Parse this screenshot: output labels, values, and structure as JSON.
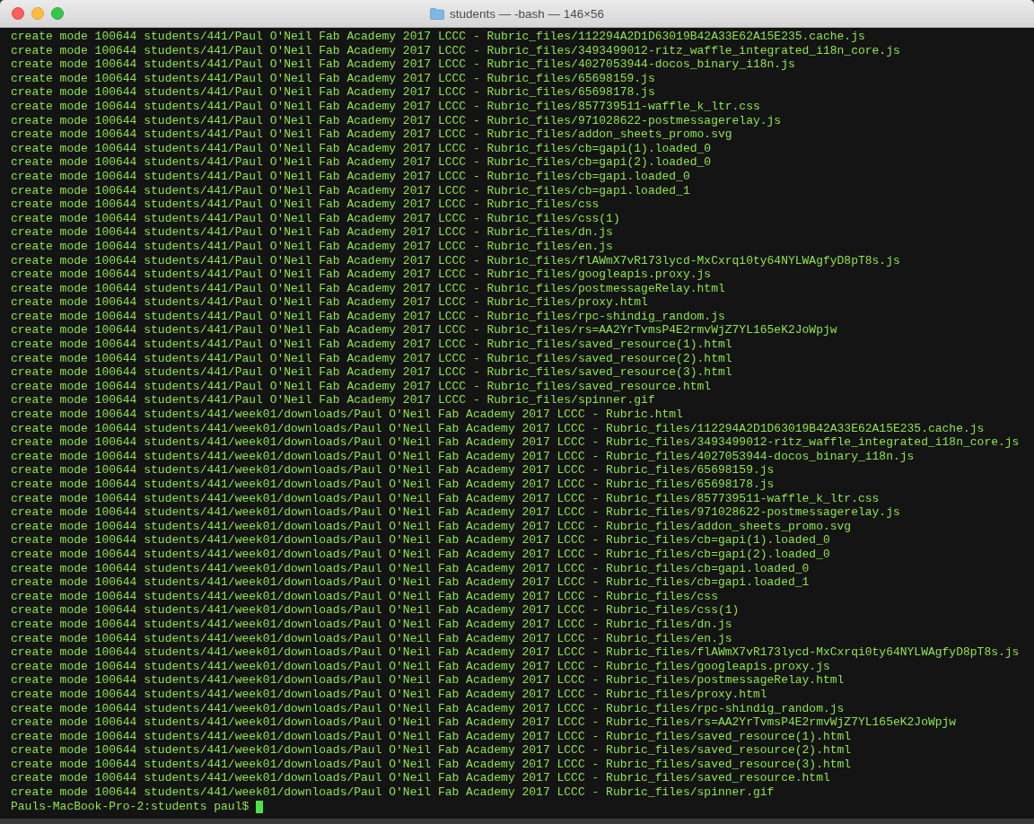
{
  "window": {
    "title": "students — -bash — 146×56"
  },
  "lines": [
    "create mode 100644 students/441/Paul O'Neil Fab Academy 2017 LCCC - Rubric_files/112294A2D1D63019B42A33E62A15E235.cache.js",
    "create mode 100644 students/441/Paul O'Neil Fab Academy 2017 LCCC - Rubric_files/3493499012-ritz_waffle_integrated_i18n_core.js",
    "create mode 100644 students/441/Paul O'Neil Fab Academy 2017 LCCC - Rubric_files/4027053944-docos_binary_i18n.js",
    "create mode 100644 students/441/Paul O'Neil Fab Academy 2017 LCCC - Rubric_files/65698159.js",
    "create mode 100644 students/441/Paul O'Neil Fab Academy 2017 LCCC - Rubric_files/65698178.js",
    "create mode 100644 students/441/Paul O'Neil Fab Academy 2017 LCCC - Rubric_files/857739511-waffle_k_ltr.css",
    "create mode 100644 students/441/Paul O'Neil Fab Academy 2017 LCCC - Rubric_files/971028622-postmessagerelay.js",
    "create mode 100644 students/441/Paul O'Neil Fab Academy 2017 LCCC - Rubric_files/addon_sheets_promo.svg",
    "create mode 100644 students/441/Paul O'Neil Fab Academy 2017 LCCC - Rubric_files/cb=gapi(1).loaded_0",
    "create mode 100644 students/441/Paul O'Neil Fab Academy 2017 LCCC - Rubric_files/cb=gapi(2).loaded_0",
    "create mode 100644 students/441/Paul O'Neil Fab Academy 2017 LCCC - Rubric_files/cb=gapi.loaded_0",
    "create mode 100644 students/441/Paul O'Neil Fab Academy 2017 LCCC - Rubric_files/cb=gapi.loaded_1",
    "create mode 100644 students/441/Paul O'Neil Fab Academy 2017 LCCC - Rubric_files/css",
    "create mode 100644 students/441/Paul O'Neil Fab Academy 2017 LCCC - Rubric_files/css(1)",
    "create mode 100644 students/441/Paul O'Neil Fab Academy 2017 LCCC - Rubric_files/dn.js",
    "create mode 100644 students/441/Paul O'Neil Fab Academy 2017 LCCC - Rubric_files/en.js",
    "create mode 100644 students/441/Paul O'Neil Fab Academy 2017 LCCC - Rubric_files/flAWmX7vR173lycd-MxCxrqi0ty64NYLWAgfyD8pT8s.js",
    "create mode 100644 students/441/Paul O'Neil Fab Academy 2017 LCCC - Rubric_files/googleapis.proxy.js",
    "create mode 100644 students/441/Paul O'Neil Fab Academy 2017 LCCC - Rubric_files/postmessageRelay.html",
    "create mode 100644 students/441/Paul O'Neil Fab Academy 2017 LCCC - Rubric_files/proxy.html",
    "create mode 100644 students/441/Paul O'Neil Fab Academy 2017 LCCC - Rubric_files/rpc-shindig_random.js",
    "create mode 100644 students/441/Paul O'Neil Fab Academy 2017 LCCC - Rubric_files/rs=AA2YrTvmsP4E2rmvWjZ7YL165eK2JoWpjw",
    "create mode 100644 students/441/Paul O'Neil Fab Academy 2017 LCCC - Rubric_files/saved_resource(1).html",
    "create mode 100644 students/441/Paul O'Neil Fab Academy 2017 LCCC - Rubric_files/saved_resource(2).html",
    "create mode 100644 students/441/Paul O'Neil Fab Academy 2017 LCCC - Rubric_files/saved_resource(3).html",
    "create mode 100644 students/441/Paul O'Neil Fab Academy 2017 LCCC - Rubric_files/saved_resource.html",
    "create mode 100644 students/441/Paul O'Neil Fab Academy 2017 LCCC - Rubric_files/spinner.gif",
    "create mode 100644 students/441/week01/downloads/Paul O'Neil Fab Academy 2017 LCCC - Rubric.html",
    "create mode 100644 students/441/week01/downloads/Paul O'Neil Fab Academy 2017 LCCC - Rubric_files/112294A2D1D63019B42A33E62A15E235.cache.js",
    "create mode 100644 students/441/week01/downloads/Paul O'Neil Fab Academy 2017 LCCC - Rubric_files/3493499012-ritz_waffle_integrated_i18n_core.js",
    "create mode 100644 students/441/week01/downloads/Paul O'Neil Fab Academy 2017 LCCC - Rubric_files/4027053944-docos_binary_i18n.js",
    "create mode 100644 students/441/week01/downloads/Paul O'Neil Fab Academy 2017 LCCC - Rubric_files/65698159.js",
    "create mode 100644 students/441/week01/downloads/Paul O'Neil Fab Academy 2017 LCCC - Rubric_files/65698178.js",
    "create mode 100644 students/441/week01/downloads/Paul O'Neil Fab Academy 2017 LCCC - Rubric_files/857739511-waffle_k_ltr.css",
    "create mode 100644 students/441/week01/downloads/Paul O'Neil Fab Academy 2017 LCCC - Rubric_files/971028622-postmessagerelay.js",
    "create mode 100644 students/441/week01/downloads/Paul O'Neil Fab Academy 2017 LCCC - Rubric_files/addon_sheets_promo.svg",
    "create mode 100644 students/441/week01/downloads/Paul O'Neil Fab Academy 2017 LCCC - Rubric_files/cb=gapi(1).loaded_0",
    "create mode 100644 students/441/week01/downloads/Paul O'Neil Fab Academy 2017 LCCC - Rubric_files/cb=gapi(2).loaded_0",
    "create mode 100644 students/441/week01/downloads/Paul O'Neil Fab Academy 2017 LCCC - Rubric_files/cb=gapi.loaded_0",
    "create mode 100644 students/441/week01/downloads/Paul O'Neil Fab Academy 2017 LCCC - Rubric_files/cb=gapi.loaded_1",
    "create mode 100644 students/441/week01/downloads/Paul O'Neil Fab Academy 2017 LCCC - Rubric_files/css",
    "create mode 100644 students/441/week01/downloads/Paul O'Neil Fab Academy 2017 LCCC - Rubric_files/css(1)",
    "create mode 100644 students/441/week01/downloads/Paul O'Neil Fab Academy 2017 LCCC - Rubric_files/dn.js",
    "create mode 100644 students/441/week01/downloads/Paul O'Neil Fab Academy 2017 LCCC - Rubric_files/en.js",
    "create mode 100644 students/441/week01/downloads/Paul O'Neil Fab Academy 2017 LCCC - Rubric_files/flAWmX7vR173lycd-MxCxrqi0ty64NYLWAgfyD8pT8s.js",
    "create mode 100644 students/441/week01/downloads/Paul O'Neil Fab Academy 2017 LCCC - Rubric_files/googleapis.proxy.js",
    "create mode 100644 students/441/week01/downloads/Paul O'Neil Fab Academy 2017 LCCC - Rubric_files/postmessageRelay.html",
    "create mode 100644 students/441/week01/downloads/Paul O'Neil Fab Academy 2017 LCCC - Rubric_files/proxy.html",
    "create mode 100644 students/441/week01/downloads/Paul O'Neil Fab Academy 2017 LCCC - Rubric_files/rpc-shindig_random.js",
    "create mode 100644 students/441/week01/downloads/Paul O'Neil Fab Academy 2017 LCCC - Rubric_files/rs=AA2YrTvmsP4E2rmvWjZ7YL165eK2JoWpjw",
    "create mode 100644 students/441/week01/downloads/Paul O'Neil Fab Academy 2017 LCCC - Rubric_files/saved_resource(1).html",
    "create mode 100644 students/441/week01/downloads/Paul O'Neil Fab Academy 2017 LCCC - Rubric_files/saved_resource(2).html",
    "create mode 100644 students/441/week01/downloads/Paul O'Neil Fab Academy 2017 LCCC - Rubric_files/saved_resource(3).html",
    "create mode 100644 students/441/week01/downloads/Paul O'Neil Fab Academy 2017 LCCC - Rubric_files/saved_resource.html",
    "create mode 100644 students/441/week01/downloads/Paul O'Neil Fab Academy 2017 LCCC - Rubric_files/spinner.gif"
  ],
  "prompt": "Pauls-MacBook-Pro-2:students paul$"
}
